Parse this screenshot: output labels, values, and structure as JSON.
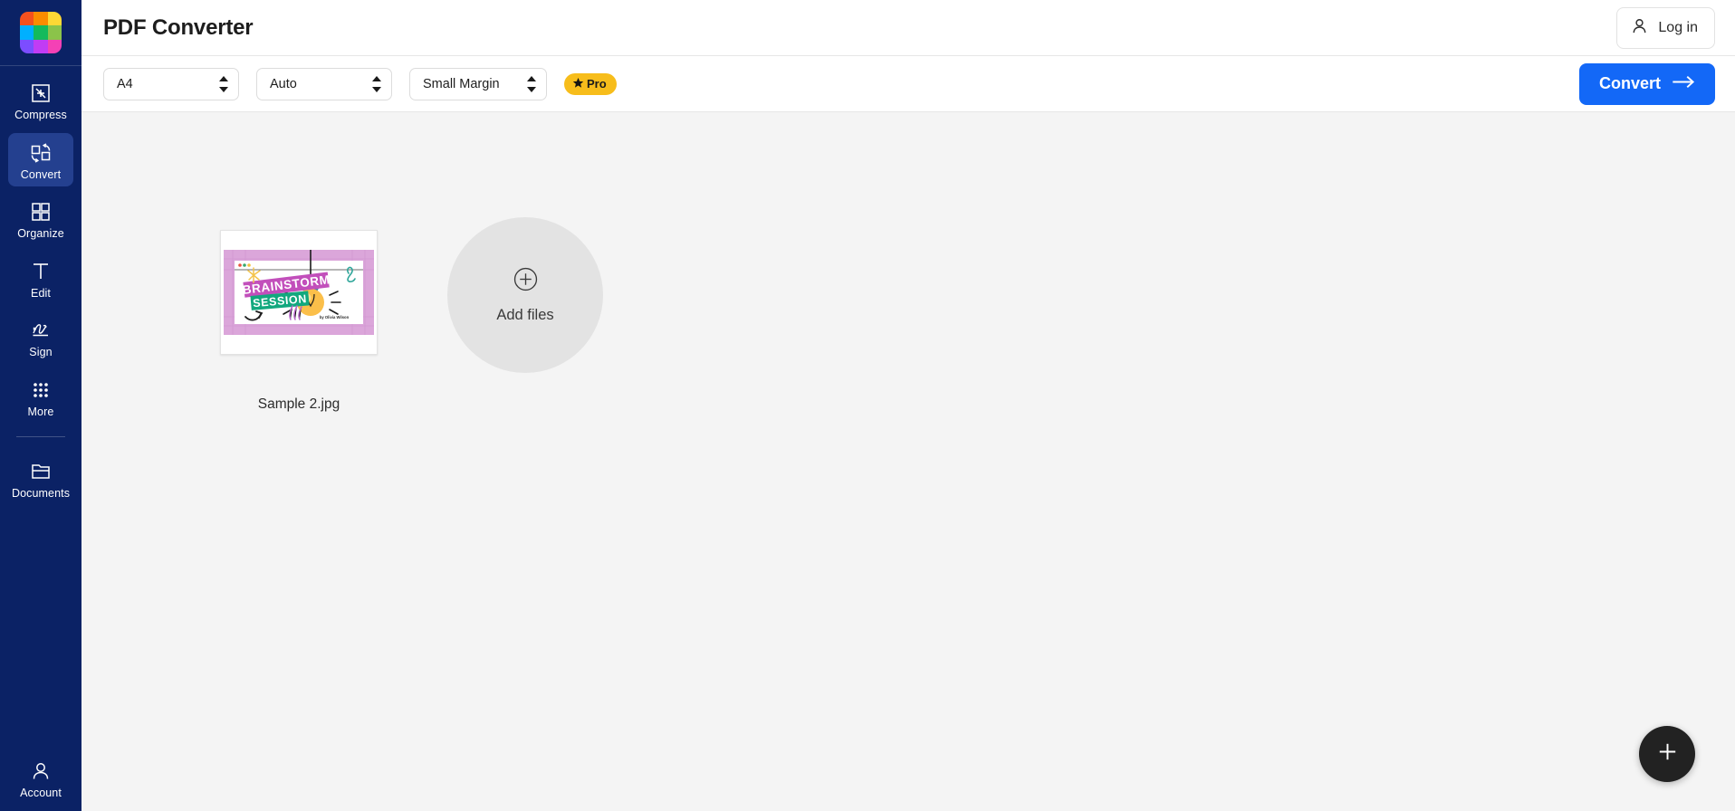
{
  "sidebar": {
    "logo": {
      "name": "app-logo",
      "colors": [
        "#f4511e",
        "#fb8c00",
        "#fdd835",
        "#00b0ff",
        "#13ba5c",
        "#8bc34a",
        "#7c4dff",
        "#c13cf4",
        "#f441b5"
      ]
    },
    "items": [
      {
        "label": "Compress",
        "icon": "compress-icon",
        "active": false
      },
      {
        "label": "Convert",
        "icon": "convert-icon",
        "active": true
      },
      {
        "label": "Organize",
        "icon": "organize-icon",
        "active": false
      },
      {
        "label": "Edit",
        "icon": "edit-icon",
        "active": false
      },
      {
        "label": "Sign",
        "icon": "sign-icon",
        "active": false
      },
      {
        "label": "More",
        "icon": "more-icon",
        "active": false
      },
      {
        "label": "Documents",
        "icon": "documents-icon",
        "active": false
      }
    ],
    "account": {
      "label": "Account",
      "icon": "account-icon"
    },
    "background_color": "#0b2265",
    "active_color": "#24408f"
  },
  "header": {
    "title": "PDF Converter",
    "login": {
      "label": "Log in",
      "icon": "user-icon"
    }
  },
  "toolbar": {
    "page_size": {
      "value": "A4",
      "name": "page-size-select"
    },
    "orientation": {
      "value": "Auto",
      "name": "orientation-select"
    },
    "margin": {
      "value": "Small Margin",
      "name": "margin-select"
    },
    "pro_badge": {
      "label": "Pro",
      "icon": "star-icon",
      "color": "#f7bd1b"
    },
    "convert": {
      "label": "Convert",
      "icon": "arrow-right-icon",
      "color": "#1368f7"
    }
  },
  "workspace": {
    "files": [
      {
        "name": "Sample 2.jpg",
        "thumbnail": {
          "alt": "Brainstorm Session lightbulb graphic",
          "title_line1": "BRAINSTORM",
          "title_line2": "SESSION",
          "byline": "by Olivia Wilson",
          "colors": {
            "frame": "#dba6da",
            "title1_bg": "#c24fbb",
            "title2_bg": "#12a87e",
            "bulb": "#fbbf4a",
            "bulb_cap": "#5b7fa6",
            "accent_teal": "#2fa69a",
            "accent_yellow": "#f4c44b"
          }
        }
      }
    ],
    "add_files": {
      "label": "Add files",
      "icon": "plus-circle-icon"
    },
    "fab": {
      "name": "add-fab",
      "icon": "plus-icon",
      "color": "#222222"
    }
  }
}
